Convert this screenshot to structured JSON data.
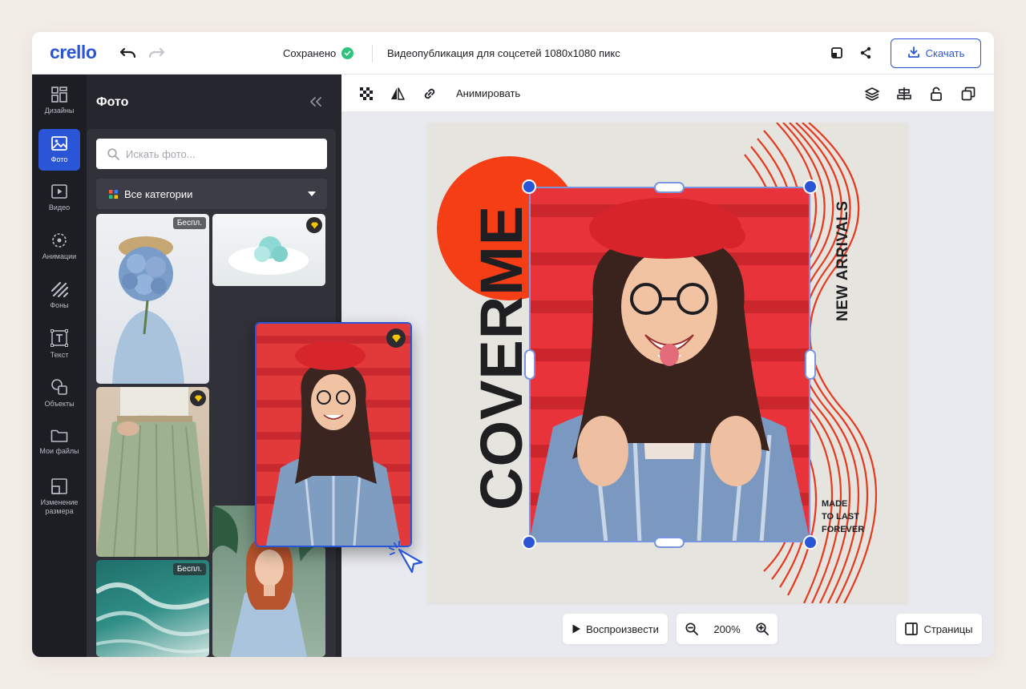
{
  "header": {
    "logo": "crello",
    "saved_label": "Сохранено",
    "document_title": "Видеопубликация для соцсетей 1080x1080 пикс",
    "download_label": "Скачать"
  },
  "rail": {
    "items": [
      {
        "label": "Дизайны",
        "icon": "grid-icon"
      },
      {
        "label": "Фото",
        "icon": "image-icon"
      },
      {
        "label": "Видео",
        "icon": "play-icon"
      },
      {
        "label": "Анимации",
        "icon": "animation-icon"
      },
      {
        "label": "Фоны",
        "icon": "background-icon"
      },
      {
        "label": "Текст",
        "icon": "text-icon"
      },
      {
        "label": "Объекты",
        "icon": "shapes-icon"
      },
      {
        "label": "Мои файлы",
        "icon": "folder-icon"
      },
      {
        "label": "Изменение размера",
        "icon": "resize-icon"
      }
    ]
  },
  "panel": {
    "title": "Фото",
    "search_placeholder": "Искать фото...",
    "category_label": "Все категории",
    "tiles": [
      {
        "badge": "Беспл.",
        "premium": false
      },
      {
        "badge": "",
        "premium": true
      },
      {
        "badge": "",
        "premium": true
      },
      {
        "badge": "",
        "premium": true
      },
      {
        "badge": "Беспл.",
        "premium": false
      },
      {
        "badge": "",
        "premium": false
      }
    ]
  },
  "toolbar": {
    "animate_label": "Анимировать"
  },
  "design": {
    "headline": "COVERME",
    "side_text": "NEW ARRIVALS",
    "tagline_lines": [
      "MADE",
      "TO LAST",
      "FOREVER"
    ]
  },
  "bottom": {
    "play_label": "Воспроизвести",
    "zoom_value": "200%",
    "pages_label": "Страницы"
  },
  "colors": {
    "accent": "#2a55d6",
    "saved_check": "#2ec27e",
    "circle_red": "#f53d16",
    "premium_gem": "#f5c400"
  }
}
